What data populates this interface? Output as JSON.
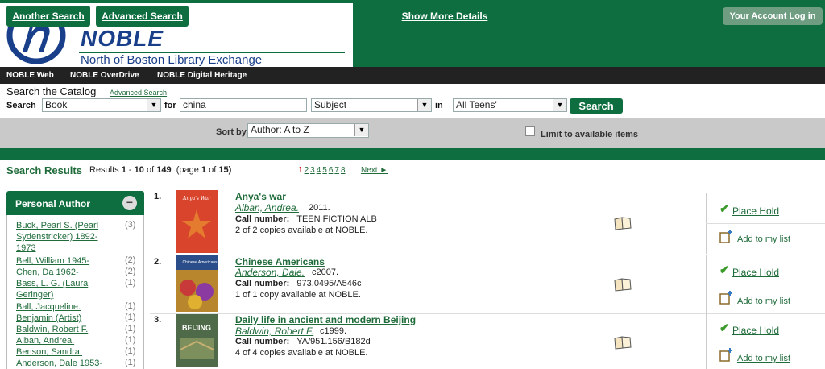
{
  "header": {
    "logo_name": "NOBLE",
    "logo_subtitle": "North of Boston Library Exchange",
    "account_button": "Your Account Log in"
  },
  "topnav": [
    "NOBLE Web",
    "NOBLE OverDrive",
    "NOBLE Digital Heritage"
  ],
  "search": {
    "title": "Search the Catalog",
    "advanced_link": "Advanced Search",
    "search_label": "Search",
    "type_value": "Book",
    "for_label": "for",
    "query": "china",
    "field_value": "Subject",
    "in_label": "in",
    "scope_value": "All Teens'",
    "button": "Search"
  },
  "toolbar": {
    "another_search": "Another Search",
    "advanced_search": "Advanced Search",
    "sort_label": "Sort by",
    "sort_value": "Author: A to Z",
    "show_more": "Show More Details",
    "limit_label": "Limit to available items"
  },
  "results": {
    "title": "Search Results",
    "info_prefix": "Results",
    "range_start": "1",
    "range_end": "10",
    "of_word": "of",
    "total": "149",
    "page_text": "(page",
    "page_num": "1",
    "page_of": "of",
    "page_total": "15)",
    "pages": [
      "1",
      "2",
      "3",
      "4",
      "5",
      "6",
      "7",
      "8"
    ],
    "next": "Next ►"
  },
  "facet": {
    "title": "Personal Author",
    "items": [
      {
        "label": "Buck, Pearl S. (Pearl Sydenstricker) 1892-1973",
        "count": "(3)"
      },
      {
        "label": "Bell, William 1945-",
        "count": "(2)"
      },
      {
        "label": "Chen, Da 1962-",
        "count": "(2)"
      },
      {
        "label": "Bass, L. G. (Laura Geringer)",
        "count": "(1)"
      },
      {
        "label": "Ball, Jacqueline.",
        "count": "(1)"
      },
      {
        "label": "Benjamin (Artist)",
        "count": "(1)"
      },
      {
        "label": "Baldwin, Robert F.",
        "count": "(1)"
      },
      {
        "label": "Alban, Andrea.",
        "count": "(1)"
      },
      {
        "label": "Benson, Sandra.",
        "count": "(1)"
      },
      {
        "label": "Anderson, Dale 1953-",
        "count": "(1)"
      }
    ]
  },
  "items": [
    {
      "num": "1.",
      "title": "Anya's war",
      "author": "Alban, Andrea.",
      "date": "2011.",
      "call_label": "Call number:",
      "call": "TEEN FICTION ALB",
      "avail": "2 of 2 copies available at NOBLE.",
      "cover_text": "Anya's War",
      "cover_color": "#d8442c"
    },
    {
      "num": "2.",
      "title": "Chinese Americans",
      "author": "Anderson, Dale.",
      "date": "c2007.",
      "call_label": "Call number:",
      "call": "973.0495/A546c",
      "avail": "1 of 1 copy available at NOBLE.",
      "cover_text": "Chinese Americans",
      "cover_color": "#b8862c"
    },
    {
      "num": "3.",
      "title": "Daily life in ancient and modern Beijing",
      "author": "Baldwin, Robert F.",
      "date": "c1999.",
      "call_label": "Call number:",
      "call": "YA/951.156/B182d",
      "avail": "4 of 4 copies available at NOBLE.",
      "cover_text": "BEIJING",
      "cover_color": "#4f6a48"
    }
  ],
  "actions": {
    "place_hold": "Place Hold",
    "add_list": "Add to my list"
  }
}
